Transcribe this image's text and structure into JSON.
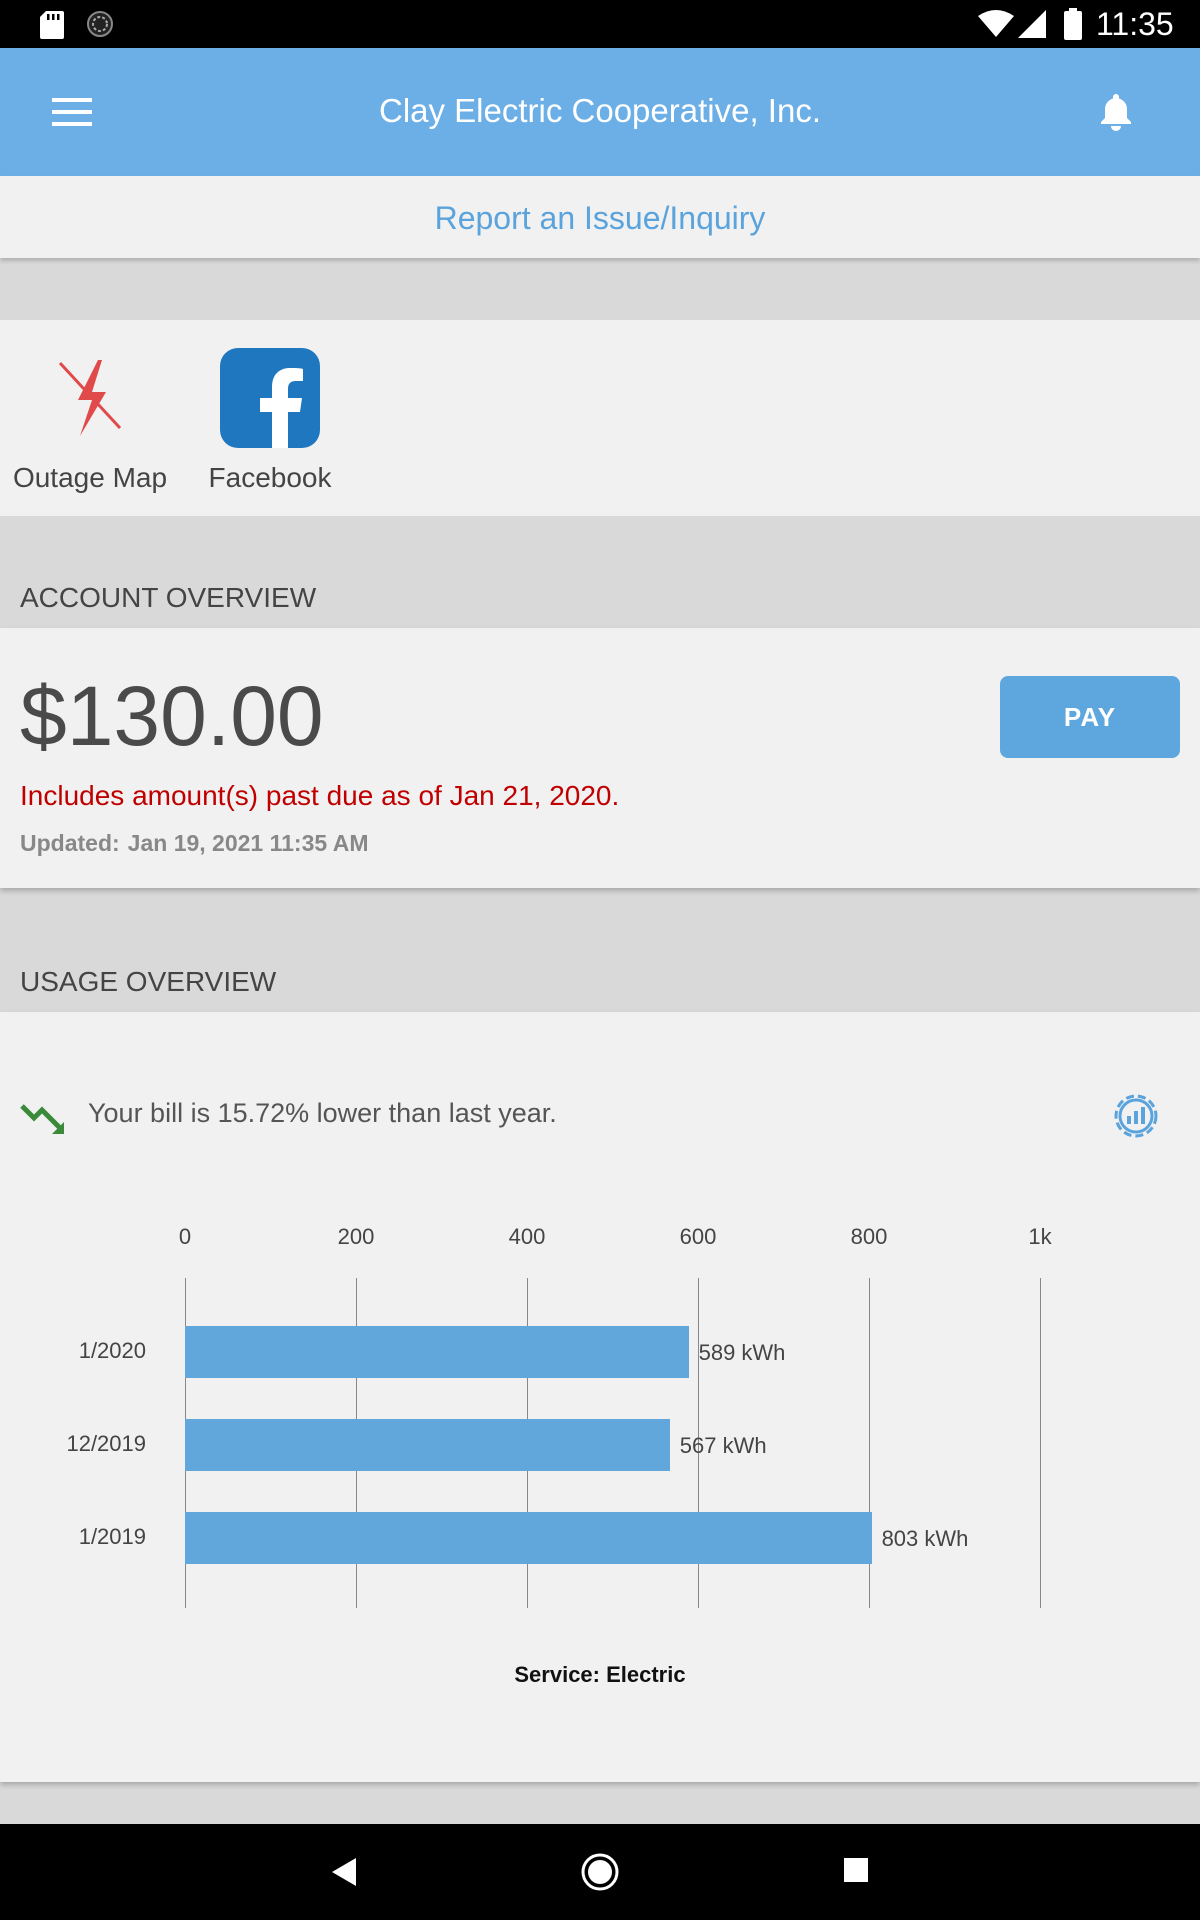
{
  "status_bar": {
    "time": "11:35",
    "icons": [
      "sd-card-icon",
      "sync-icon",
      "wifi-icon",
      "signal-icon",
      "battery-icon"
    ]
  },
  "app_bar": {
    "title": "Clay Electric Cooperative, Inc.",
    "left_icon": "menu-icon",
    "right_icon": "bell-icon",
    "background": "#6caee6"
  },
  "report_link": {
    "label": "Report an Issue/Inquiry"
  },
  "quick_links": [
    {
      "label": "Outage Map",
      "icon": "outage-map-icon"
    },
    {
      "label": "Facebook",
      "icon": "facebook-icon"
    }
  ],
  "account_overview": {
    "heading": "ACCOUNT OVERVIEW",
    "amount": "$130.00",
    "pay_label": "PAY",
    "past_due_notice": "Includes amount(s) past due as of Jan 21, 2020.",
    "updated_label": "Updated:",
    "updated_value": "Jan 19, 2021 11:35 AM"
  },
  "usage_overview": {
    "heading": "USAGE OVERVIEW",
    "comparison": "Your bill is 15.72% lower than last year.",
    "trend_icon": "trend-down-icon",
    "settings_icon": "usage-settings-icon",
    "service_label": "Service: Electric"
  },
  "chart_data": {
    "type": "bar",
    "orientation": "horizontal",
    "categories": [
      "1/2020",
      "12/2019",
      "1/2019"
    ],
    "values": [
      589,
      567,
      803
    ],
    "value_labels": [
      "589 kWh",
      "567 kWh",
      "803 kWh"
    ],
    "x_ticks": [
      "0",
      "200",
      "400",
      "600",
      "800",
      "1k"
    ],
    "xlim": [
      0,
      1000
    ],
    "grid": true,
    "bar_color": "#62a7dc",
    "xlabel": "",
    "ylabel": ""
  },
  "nav_bar": {
    "icons": [
      "back-icon",
      "home-icon",
      "recents-icon"
    ]
  }
}
